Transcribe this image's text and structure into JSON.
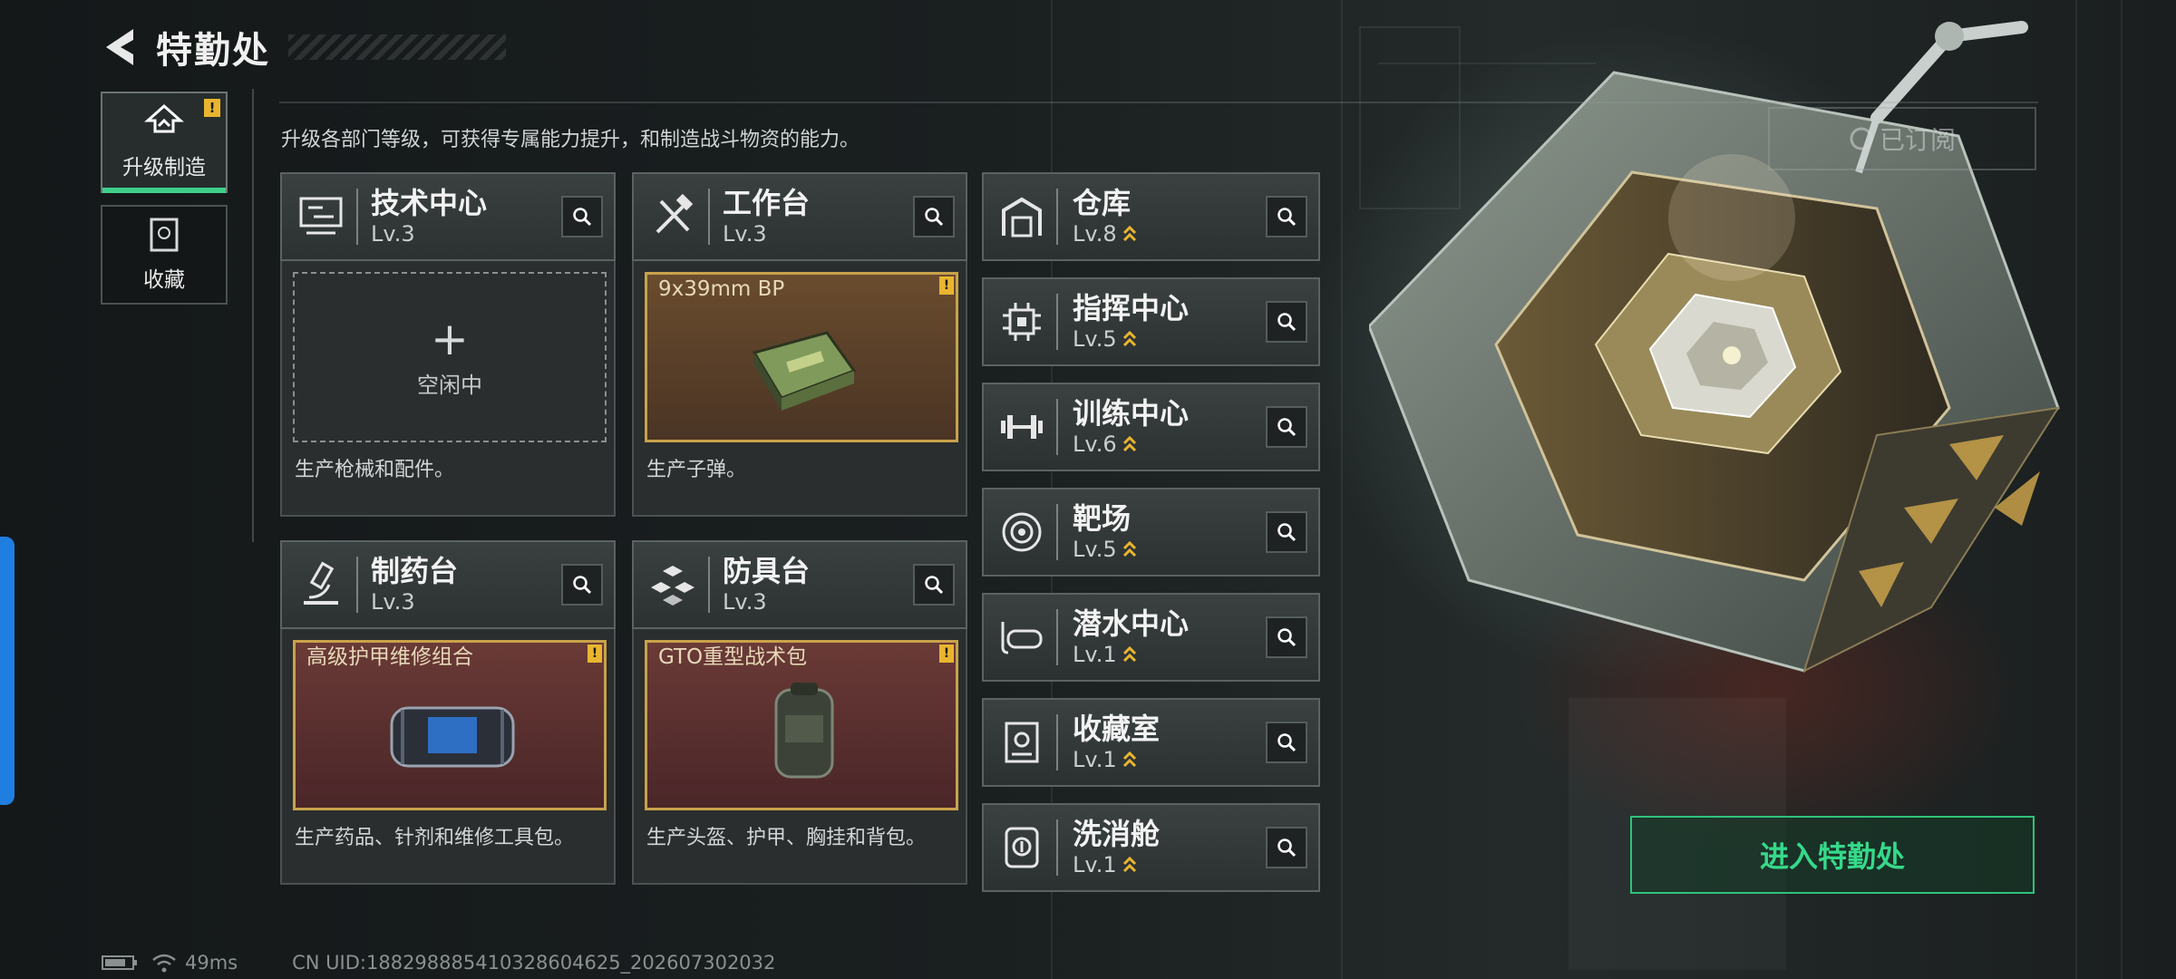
{
  "header": {
    "title": "特勤处"
  },
  "side_tabs": [
    {
      "label": "升级制造",
      "active": true,
      "alert": "!"
    },
    {
      "label": "收藏",
      "active": false
    }
  ],
  "description": "升级各部门等级，可获得专属能力提升，和制造战斗物资的能力。",
  "subscribed_label": "已订阅",
  "departments": [
    {
      "name": "技术中心",
      "level": "Lv.3",
      "slot_state": "空闲中",
      "slot_item": "",
      "produce": "生产枪械和配件。"
    },
    {
      "name": "工作台",
      "level": "Lv.3",
      "slot_item": "9x39mm BP",
      "alert": "!",
      "produce": "生产子弹。"
    },
    {
      "name": "制药台",
      "level": "Lv.3",
      "slot_item": "高级护甲维修组合",
      "alert": "!",
      "produce": "生产药品、针剂和维修工具包。"
    },
    {
      "name": "防具台",
      "level": "Lv.3",
      "slot_item": "GTO重型战术包",
      "alert": "!",
      "produce": "生产头盔、护甲、胸挂和背包。"
    }
  ],
  "facilities": [
    {
      "name": "仓库",
      "level": "Lv.8"
    },
    {
      "name": "指挥中心",
      "level": "Lv.5"
    },
    {
      "name": "训练中心",
      "level": "Lv.6"
    },
    {
      "name": "靶场",
      "level": "Lv.5"
    },
    {
      "name": "潜水中心",
      "level": "Lv.1"
    },
    {
      "name": "收藏室",
      "level": "Lv.1"
    },
    {
      "name": "洗消舱",
      "level": "Lv.1"
    }
  ],
  "enter_button": "进入特勤处",
  "footer": {
    "ping": "49ms",
    "uid": "CN UID:18829888541032860462​5_202607302032"
  },
  "colors": {
    "accent_green": "#36d98a",
    "alert_yellow": "#e9b530",
    "item_border": "#c9a24a",
    "edge_blue": "#1f7ee0"
  },
  "icons": {
    "back": "chevron-left-icon",
    "upgrade": "upgrade-icon",
    "collection": "collection-icon",
    "search": "search-icon",
    "level_up": "double-chevron-up-icon",
    "wifi": "wifi-icon",
    "battery": "battery-icon"
  }
}
